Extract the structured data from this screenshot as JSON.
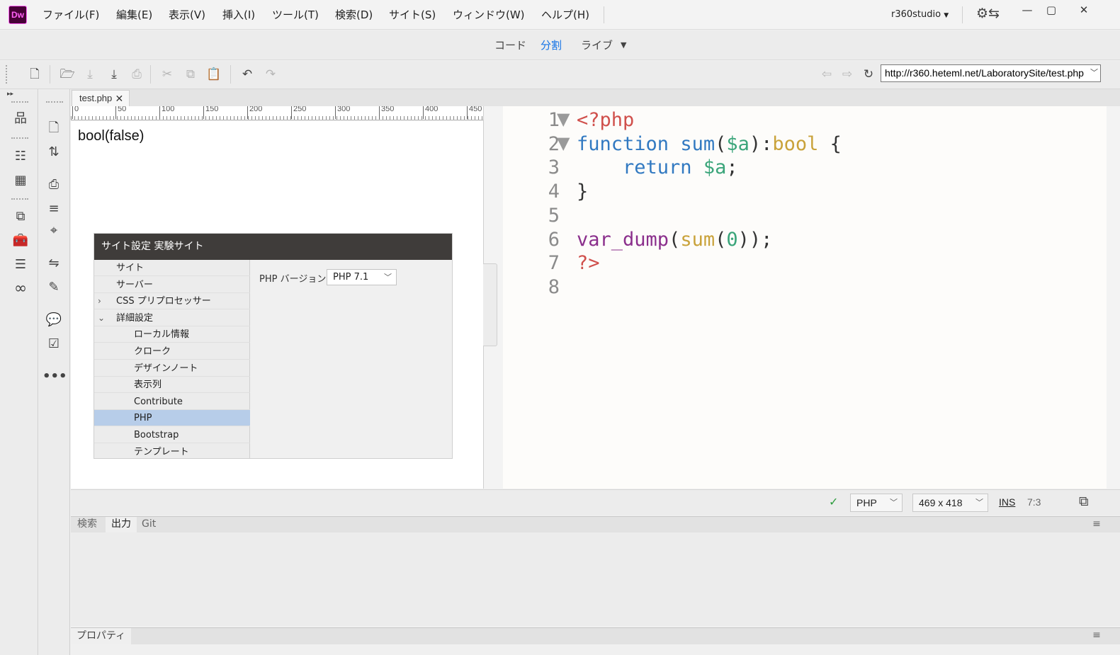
{
  "app": {
    "logo_text": "Dw",
    "workspace": "r360studio"
  },
  "menu": [
    "ファイル(F)",
    "編集(E)",
    "表示(V)",
    "挿入(I)",
    "ツール(T)",
    "検索(D)",
    "サイト(S)",
    "ウィンドウ(W)",
    "ヘルプ(H)"
  ],
  "view_modes": {
    "code": "コード",
    "split": "分割",
    "live": "ライブ",
    "active": "分割"
  },
  "toolbar": {
    "url": "http://r360.heteml.net/LaboratorySite/test.php"
  },
  "document": {
    "tab_name": "test.php",
    "output": "bool(false)"
  },
  "ruler": [
    "0",
    "50",
    "100",
    "150",
    "200",
    "250",
    "300",
    "350",
    "400",
    "450"
  ],
  "dialog": {
    "title": "サイト設定 実験サイト",
    "tree": [
      {
        "label": "サイト",
        "level": 1,
        "caret": ""
      },
      {
        "label": "サーバー",
        "level": 1,
        "caret": ""
      },
      {
        "label": "CSS プリプロセッサー",
        "level": 1,
        "caret": ">"
      },
      {
        "label": "詳細設定",
        "level": 1,
        "caret": "v"
      },
      {
        "label": "ローカル情報",
        "level": 2,
        "caret": ""
      },
      {
        "label": "クローク",
        "level": 2,
        "caret": ""
      },
      {
        "label": "デザインノート",
        "level": 2,
        "caret": ""
      },
      {
        "label": "表示列",
        "level": 2,
        "caret": ""
      },
      {
        "label": "Contribute",
        "level": 2,
        "caret": ""
      },
      {
        "label": "PHP",
        "level": 2,
        "caret": "",
        "selected": true
      },
      {
        "label": "Bootstrap",
        "level": 2,
        "caret": ""
      },
      {
        "label": "テンプレート",
        "level": 2,
        "caret": ""
      }
    ],
    "php_version_label": "PHP バージョン：",
    "php_version_value": "PHP 7.1"
  },
  "code": {
    "line_numbers": [
      "1",
      "2",
      "3",
      "4",
      "5",
      "6",
      "7",
      "8"
    ],
    "lines": [
      [
        {
          "t": "<?php",
          "c": "tag"
        }
      ],
      [
        {
          "t": "function",
          "c": "kw"
        },
        {
          "t": " ",
          "c": ""
        },
        {
          "t": "sum",
          "c": "fn"
        },
        {
          "t": "(",
          "c": ""
        },
        {
          "t": "$a",
          "c": "var"
        },
        {
          "t": "):",
          "c": ""
        },
        {
          "t": "bool",
          "c": "type"
        },
        {
          "t": " {",
          "c": ""
        }
      ],
      [
        {
          "t": "    ",
          "c": ""
        },
        {
          "t": "return",
          "c": "kw"
        },
        {
          "t": " ",
          "c": ""
        },
        {
          "t": "$a",
          "c": "var"
        },
        {
          "t": ";",
          "c": ""
        }
      ],
      [
        {
          "t": "}",
          "c": ""
        }
      ],
      [],
      [
        {
          "t": "var_dump",
          "c": "vfn"
        },
        {
          "t": "(",
          "c": ""
        },
        {
          "t": "sum",
          "c": "call"
        },
        {
          "t": "(",
          "c": ""
        },
        {
          "t": "0",
          "c": "num"
        },
        {
          "t": "));",
          "c": ""
        }
      ],
      [
        {
          "t": "?>",
          "c": "tag"
        }
      ],
      []
    ],
    "folded_lines": [
      1,
      2
    ]
  },
  "status": {
    "language": "PHP",
    "size": "469 x 418",
    "mode": "INS",
    "cursor": "7:3"
  },
  "panels": {
    "tabs": [
      "検索",
      "出力",
      "Git"
    ],
    "active": "出力",
    "properties": "プロパティ"
  }
}
